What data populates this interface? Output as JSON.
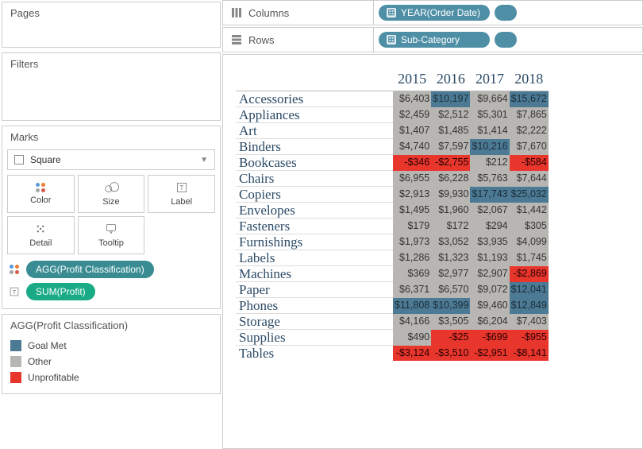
{
  "side": {
    "pages_title": "Pages",
    "filters_title": "Filters",
    "marks_title": "Marks",
    "marktype": "Square",
    "buttons": {
      "color": "Color",
      "size": "Size",
      "label": "Label",
      "detail": "Detail",
      "tooltip": "Tooltip"
    },
    "mark_pills": {
      "color_pill": "AGG(Profit Classification)",
      "label_pill": "SUM(Profit)"
    },
    "legend_title": "AGG(Profit Classification)",
    "legend": [
      {
        "label": "Goal Met",
        "color": "#4c7a94"
      },
      {
        "label": "Other",
        "color": "#b8b6b2"
      },
      {
        "label": "Unprofitable",
        "color": "#e8362d"
      }
    ]
  },
  "shelves": {
    "columns_label": "Columns",
    "rows_label": "Rows",
    "columns_pill": "YEAR(Order Date)",
    "rows_pill": "Sub-Category"
  },
  "chart_data": {
    "type": "table",
    "years": [
      "2015",
      "2016",
      "2017",
      "2018"
    ],
    "rows": [
      {
        "name": "Accessories",
        "cells": [
          {
            "v": "$6,403",
            "c": "other"
          },
          {
            "v": "$10,197",
            "c": "goal"
          },
          {
            "v": "$9,664",
            "c": "other"
          },
          {
            "v": "$15,672",
            "c": "goal"
          }
        ]
      },
      {
        "name": "Appliances",
        "cells": [
          {
            "v": "$2,459",
            "c": "other"
          },
          {
            "v": "$2,512",
            "c": "other"
          },
          {
            "v": "$5,301",
            "c": "other"
          },
          {
            "v": "$7,865",
            "c": "other"
          }
        ]
      },
      {
        "name": "Art",
        "cells": [
          {
            "v": "$1,407",
            "c": "other"
          },
          {
            "v": "$1,485",
            "c": "other"
          },
          {
            "v": "$1,414",
            "c": "other"
          },
          {
            "v": "$2,222",
            "c": "other"
          }
        ]
      },
      {
        "name": "Binders",
        "cells": [
          {
            "v": "$4,740",
            "c": "other"
          },
          {
            "v": "$7,597",
            "c": "other"
          },
          {
            "v": "$10,216",
            "c": "goal"
          },
          {
            "v": "$7,670",
            "c": "other"
          }
        ]
      },
      {
        "name": "Bookcases",
        "cells": [
          {
            "v": "-$346",
            "c": "unprof"
          },
          {
            "v": "-$2,755",
            "c": "unprof"
          },
          {
            "v": "$212",
            "c": "other"
          },
          {
            "v": "-$584",
            "c": "unprof"
          }
        ]
      },
      {
        "name": "Chairs",
        "cells": [
          {
            "v": "$6,955",
            "c": "other"
          },
          {
            "v": "$6,228",
            "c": "other"
          },
          {
            "v": "$5,763",
            "c": "other"
          },
          {
            "v": "$7,644",
            "c": "other"
          }
        ]
      },
      {
        "name": "Copiers",
        "cells": [
          {
            "v": "$2,913",
            "c": "other"
          },
          {
            "v": "$9,930",
            "c": "other"
          },
          {
            "v": "$17,743",
            "c": "goal"
          },
          {
            "v": "$25,032",
            "c": "goal"
          }
        ]
      },
      {
        "name": "Envelopes",
        "cells": [
          {
            "v": "$1,495",
            "c": "other"
          },
          {
            "v": "$1,960",
            "c": "other"
          },
          {
            "v": "$2,067",
            "c": "other"
          },
          {
            "v": "$1,442",
            "c": "other"
          }
        ]
      },
      {
        "name": "Fasteners",
        "cells": [
          {
            "v": "$179",
            "c": "other"
          },
          {
            "v": "$172",
            "c": "other"
          },
          {
            "v": "$294",
            "c": "other"
          },
          {
            "v": "$305",
            "c": "other"
          }
        ]
      },
      {
        "name": "Furnishings",
        "cells": [
          {
            "v": "$1,973",
            "c": "other"
          },
          {
            "v": "$3,052",
            "c": "other"
          },
          {
            "v": "$3,935",
            "c": "other"
          },
          {
            "v": "$4,099",
            "c": "other"
          }
        ]
      },
      {
        "name": "Labels",
        "cells": [
          {
            "v": "$1,286",
            "c": "other"
          },
          {
            "v": "$1,323",
            "c": "other"
          },
          {
            "v": "$1,193",
            "c": "other"
          },
          {
            "v": "$1,745",
            "c": "other"
          }
        ]
      },
      {
        "name": "Machines",
        "cells": [
          {
            "v": "$369",
            "c": "other"
          },
          {
            "v": "$2,977",
            "c": "other"
          },
          {
            "v": "$2,907",
            "c": "other"
          },
          {
            "v": "-$2,869",
            "c": "unprof"
          }
        ]
      },
      {
        "name": "Paper",
        "cells": [
          {
            "v": "$6,371",
            "c": "other"
          },
          {
            "v": "$6,570",
            "c": "other"
          },
          {
            "v": "$9,072",
            "c": "other"
          },
          {
            "v": "$12,041",
            "c": "goal"
          }
        ]
      },
      {
        "name": "Phones",
        "cells": [
          {
            "v": "$11,808",
            "c": "goal"
          },
          {
            "v": "$10,399",
            "c": "goal"
          },
          {
            "v": "$9,460",
            "c": "other"
          },
          {
            "v": "$12,849",
            "c": "goal"
          }
        ]
      },
      {
        "name": "Storage",
        "cells": [
          {
            "v": "$4,166",
            "c": "other"
          },
          {
            "v": "$3,505",
            "c": "other"
          },
          {
            "v": "$6,204",
            "c": "other"
          },
          {
            "v": "$7,403",
            "c": "other"
          }
        ]
      },
      {
        "name": "Supplies",
        "cells": [
          {
            "v": "$490",
            "c": "other"
          },
          {
            "v": "-$25",
            "c": "unprof"
          },
          {
            "v": "-$699",
            "c": "unprof"
          },
          {
            "v": "-$955",
            "c": "unprof"
          }
        ]
      },
      {
        "name": "Tables",
        "cells": [
          {
            "v": "-$3,124",
            "c": "unprof"
          },
          {
            "v": "-$3,510",
            "c": "unprof"
          },
          {
            "v": "-$2,951",
            "c": "unprof"
          },
          {
            "v": "-$8,141",
            "c": "unprof"
          }
        ]
      }
    ]
  }
}
